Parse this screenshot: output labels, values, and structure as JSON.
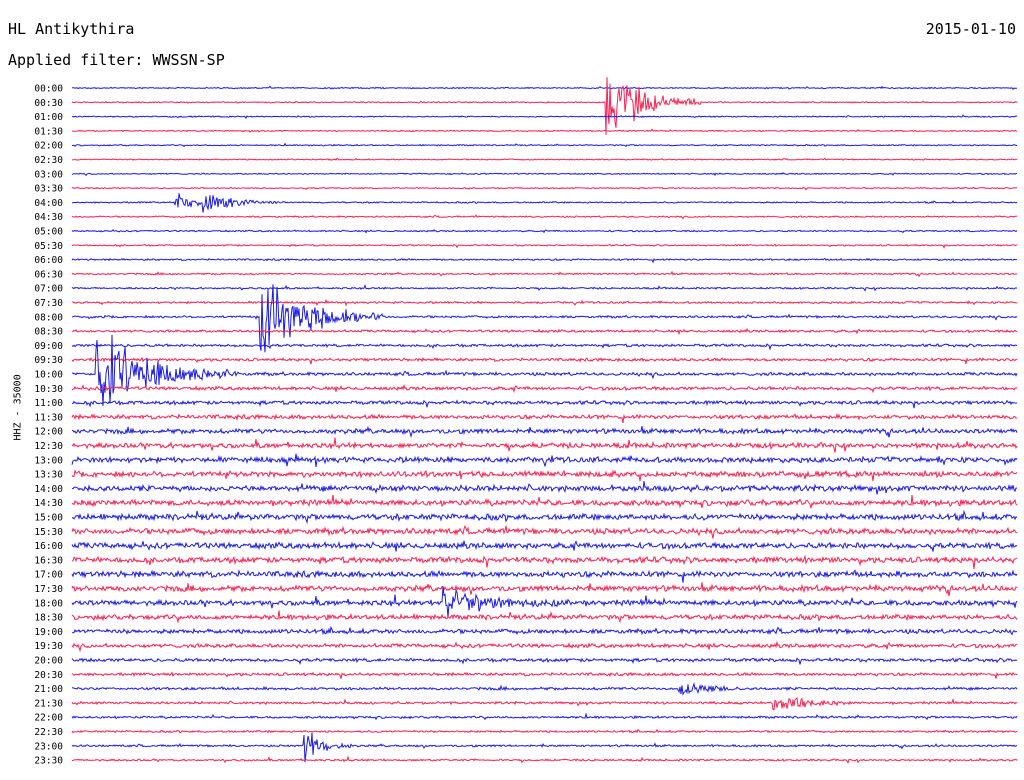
{
  "header": {
    "station": "HL Antikythira",
    "date": "2015-01-10",
    "filter": "Applied filter: WWSSN-SP"
  },
  "colors": {
    "trace_a": "#1a1aee",
    "trace_b": "#ff2050"
  },
  "chart_data": {
    "type": "line",
    "title": "HL Antikythira",
    "ylabel": "HHZ - 35000",
    "xlabel": "",
    "grid": false,
    "legend": "none",
    "tick_labels": [
      "00:00",
      "00:30",
      "01:00",
      "01:30",
      "02:00",
      "02:30",
      "03:00",
      "03:30",
      "04:00",
      "04:30",
      "05:00",
      "05:30",
      "06:00",
      "06:30",
      "07:00",
      "07:30",
      "08:00",
      "08:30",
      "09:00",
      "09:30",
      "10:00",
      "10:30",
      "11:00",
      "11:30",
      "12:00",
      "12:30",
      "13:00",
      "13:30",
      "14:00",
      "14:30",
      "15:00",
      "15:30",
      "16:00",
      "16:30",
      "17:00",
      "17:30",
      "18:00",
      "18:30",
      "19:00",
      "19:30",
      "20:00",
      "20:30",
      "21:00",
      "21:30",
      "22:00",
      "22:30",
      "23:00",
      "23:30"
    ],
    "trace_color_order": [
      "blue",
      "red"
    ],
    "noise_level": [
      0.5,
      0.5,
      0.5,
      0.5,
      0.5,
      0.5,
      0.5,
      0.5,
      0.6,
      0.6,
      0.6,
      0.6,
      0.7,
      0.7,
      0.7,
      0.8,
      0.9,
      1.0,
      1.1,
      1.2,
      1.3,
      1.4,
      1.5,
      1.7,
      1.9,
      2.1,
      2.2,
      2.3,
      2.4,
      2.4,
      2.4,
      2.4,
      2.4,
      2.4,
      2.4,
      2.3,
      2.2,
      2.0,
      1.8,
      1.6,
      1.4,
      1.2,
      1.1,
      1.0,
      0.9,
      0.8,
      0.8,
      0.8
    ],
    "events": [
      {
        "row": 1,
        "minute": 17.0,
        "amp": 45,
        "dur": 3.0
      },
      {
        "row": 8,
        "minute": 3.3,
        "amp": 12,
        "dur": 2.5
      },
      {
        "row": 8,
        "minute": 4.2,
        "amp": 10,
        "dur": 2.5
      },
      {
        "row": 16,
        "minute": 6.0,
        "amp": 50,
        "dur": 4.0
      },
      {
        "row": 20,
        "minute": 0.8,
        "amp": 55,
        "dur": 4.5
      },
      {
        "row": 36,
        "minute": 11.8,
        "amp": 20,
        "dur": 4.0
      },
      {
        "row": 42,
        "minute": 19.3,
        "amp": 12,
        "dur": 2.0
      },
      {
        "row": 43,
        "minute": 22.3,
        "amp": 14,
        "dur": 2.5
      },
      {
        "row": 46,
        "minute": 7.4,
        "amp": 20,
        "dur": 1.5
      }
    ]
  }
}
